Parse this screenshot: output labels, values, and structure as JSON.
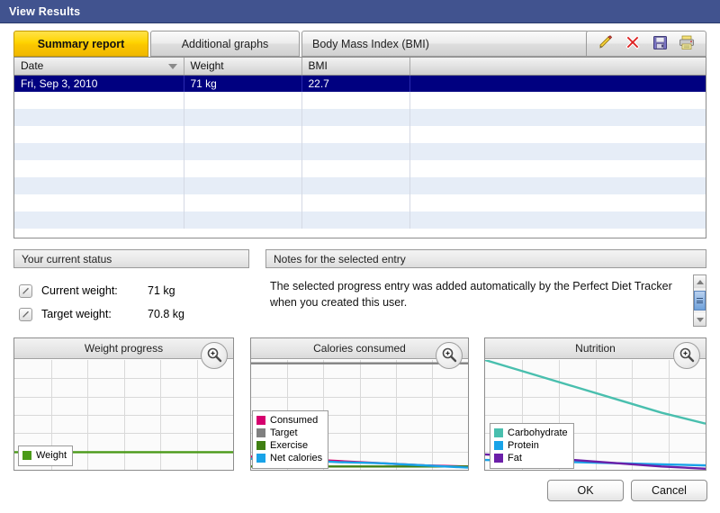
{
  "window": {
    "title": "View Results"
  },
  "tabs": [
    {
      "label": "Summary report",
      "active": true
    },
    {
      "label": "Additional graphs",
      "active": false
    },
    {
      "label": "Body Mass Index (BMI)",
      "active": false
    }
  ],
  "toolbar": {
    "edit_icon": "pencil-icon",
    "delete_icon": "red-x-icon",
    "save_icon": "floppy-disk-icon",
    "print_icon": "printer-icon"
  },
  "table": {
    "columns": [
      "Date",
      "Weight",
      "BMI",
      ""
    ],
    "sort_column": "Date",
    "sort_direction": "descending",
    "rows": [
      {
        "date": "Fri, Sep 3, 2010",
        "weight": "71 kg",
        "bmi": "22.7",
        "blank": "",
        "selected": true
      },
      {
        "date": "",
        "weight": "",
        "bmi": "",
        "blank": "",
        "selected": false
      },
      {
        "date": "",
        "weight": "",
        "bmi": "",
        "blank": "",
        "selected": false
      },
      {
        "date": "",
        "weight": "",
        "bmi": "",
        "blank": "",
        "selected": false
      },
      {
        "date": "",
        "weight": "",
        "bmi": "",
        "blank": "",
        "selected": false
      },
      {
        "date": "",
        "weight": "",
        "bmi": "",
        "blank": "",
        "selected": false
      },
      {
        "date": "",
        "weight": "",
        "bmi": "",
        "blank": "",
        "selected": false
      },
      {
        "date": "",
        "weight": "",
        "bmi": "",
        "blank": "",
        "selected": false
      },
      {
        "date": "",
        "weight": "",
        "bmi": "",
        "blank": "",
        "selected": false
      }
    ]
  },
  "status_panel": {
    "title": "Your current status",
    "rows": [
      {
        "label": "Current weight:",
        "value": "71 kg"
      },
      {
        "label": "Target weight:",
        "value": "70.8 kg"
      }
    ]
  },
  "notes_panel": {
    "title": "Notes for the selected entry",
    "text": "The selected progress entry was added automatically by the Perfect Diet Tracker when you created this user."
  },
  "buttons": {
    "ok": "OK",
    "cancel": "Cancel"
  },
  "colors": {
    "titlebar": "#41538f",
    "active_tab": "#ffd400",
    "selection": "#000080",
    "row_stripe": "#e6edf7"
  },
  "chart_data": [
    {
      "id": "weight",
      "type": "line",
      "title": "Weight progress",
      "xlabel": "",
      "ylabel": "",
      "grid": true,
      "legend_position": "bottom-left",
      "zoom_icon": "magnifier-plus-icon",
      "x": [
        0,
        1,
        2,
        3,
        4,
        5
      ],
      "ylim": [
        0,
        100
      ],
      "series": [
        {
          "name": "Weight",
          "color": "#4a9a18",
          "values": [
            16,
            16,
            16,
            16,
            16,
            16
          ]
        }
      ]
    },
    {
      "id": "calories",
      "type": "line",
      "title": "Calories consumed",
      "xlabel": "",
      "ylabel": "",
      "grid": true,
      "legend_position": "bottom-left",
      "zoom_icon": "magnifier-plus-icon",
      "x": [
        0,
        1,
        2,
        3,
        4,
        5
      ],
      "ylim": [
        0,
        100
      ],
      "series": [
        {
          "name": "Consumed",
          "color": "#d6006e",
          "values": [
            12,
            10,
            8,
            6,
            4,
            3
          ]
        },
        {
          "name": "Target",
          "color": "#808080",
          "values": [
            97,
            97,
            97,
            97,
            97,
            97
          ]
        },
        {
          "name": "Exercise",
          "color": "#3f7f12",
          "values": [
            3,
            3,
            3,
            3,
            3,
            3
          ]
        },
        {
          "name": "Net calories",
          "color": "#19a3e8",
          "values": [
            10,
            9,
            7,
            6,
            4,
            2
          ]
        }
      ]
    },
    {
      "id": "nutrition",
      "type": "line",
      "title": "Nutrition",
      "xlabel": "",
      "ylabel": "",
      "grid": true,
      "legend_position": "bottom-left",
      "zoom_icon": "magnifier-plus-icon",
      "x": [
        0,
        1,
        2,
        3,
        4,
        5
      ],
      "ylim": [
        0,
        100
      ],
      "series": [
        {
          "name": "Carbohydrate",
          "color": "#49bfae",
          "values": [
            100,
            88,
            76,
            64,
            52,
            42
          ]
        },
        {
          "name": "Protein",
          "color": "#19a3e8",
          "values": [
            9,
            8,
            7,
            6,
            5,
            4
          ]
        },
        {
          "name": "Fat",
          "color": "#6b1fa8",
          "values": [
            14,
            12,
            9,
            6,
            3,
            1
          ]
        }
      ]
    }
  ]
}
